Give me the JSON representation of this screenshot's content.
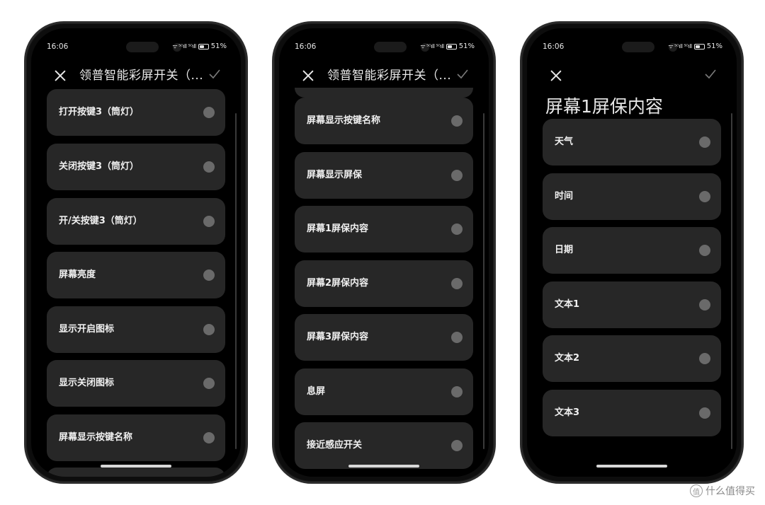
{
  "status_bar": {
    "time": "16:06",
    "signal": "ᴴᴰ∥ ᴴᴰ∥",
    "battery": "51%"
  },
  "phones": [
    {
      "title": "领普智能彩屏开关（...",
      "items": [
        "打开按键3（筒灯）",
        "关闭按键3（筒灯）",
        "开/关按键3（筒灯）",
        "屏幕亮度",
        "显示开启图标",
        "显示关闭图标",
        "屏幕显示按键名称"
      ]
    },
    {
      "title": "领普智能彩屏开关（...",
      "items": [
        "屏幕显示按键名称",
        "屏幕显示屏保",
        "屏幕1屏保内容",
        "屏幕2屏保内容",
        "屏幕3屏保内容",
        "息屏",
        "接近感应开关"
      ]
    },
    {
      "title": "屏幕1屏保内容",
      "items": [
        "天气",
        "时间",
        "日期",
        "文本1",
        "文本2",
        "文本3"
      ]
    }
  ],
  "watermark": "什么值得买",
  "colors": {
    "card": "#272727",
    "radio": "#6a6a6a",
    "screen": "#000000",
    "text": "#f0f0f0"
  }
}
